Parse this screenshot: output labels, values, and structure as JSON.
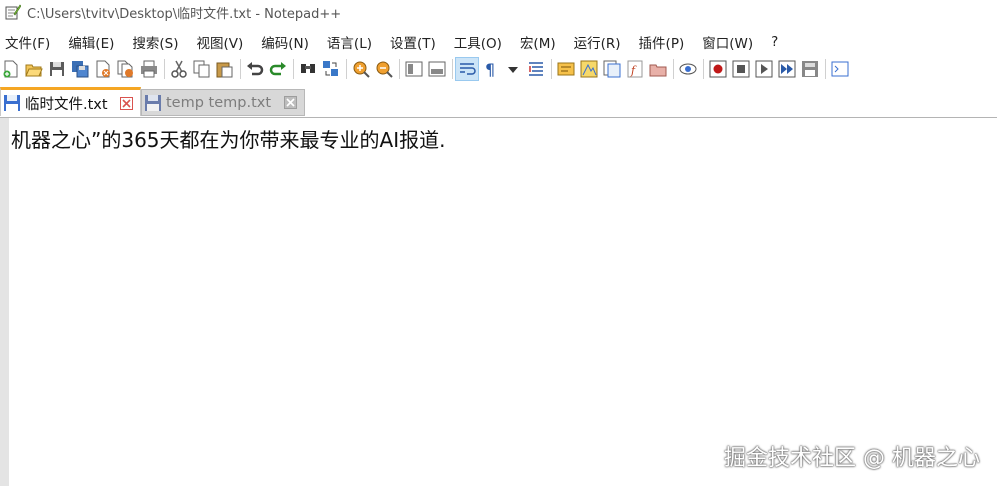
{
  "window": {
    "title": "C:\\Users\\tvitv\\Desktop\\临时文件.txt - Notepad++"
  },
  "menu": {
    "items": [
      "文件(F)",
      "编辑(E)",
      "搜索(S)",
      "视图(V)",
      "编码(N)",
      "语言(L)",
      "设置(T)",
      "工具(O)",
      "宏(M)",
      "运行(R)",
      "插件(P)",
      "窗口(W)",
      "?"
    ]
  },
  "toolbar": {
    "icons": [
      "new-file-icon",
      "open-file-icon",
      "save-icon",
      "save-all-icon",
      "close-icon",
      "close-all-icon",
      "print-icon",
      "cut-icon",
      "copy-icon",
      "paste-icon",
      "undo-icon",
      "redo-icon",
      "find-icon",
      "replace-icon",
      "zoom-in-icon",
      "zoom-out-icon",
      "sync-vertical-icon",
      "sync-horizontal-icon",
      "word-wrap-icon",
      "show-all-chars-icon",
      "dropdown-icon",
      "indent-guide-icon",
      "define-language-icon",
      "document-map-icon",
      "function-list-icon",
      "folder-workspace-icon",
      "monitor-icon",
      "eye-icon",
      "record-macro-icon",
      "stop-macro-icon",
      "play-macro-icon",
      "run-macro-multiple-icon",
      "save-macro-icon",
      "console-icon"
    ]
  },
  "tabs": [
    {
      "label": "临时文件.txt",
      "active": true
    },
    {
      "label": "temp temp.txt",
      "active": false
    }
  ],
  "editor": {
    "lines": [
      "机器之心”的365天都在为你带来最专业的AI报道."
    ]
  },
  "watermark": {
    "text": "掘金技术社区 @ 机器之心"
  },
  "colors": {
    "active_tab_accent": "#f5a623",
    "close_red": "#d9534f",
    "tab_save_blue": "#3a6fd0"
  }
}
